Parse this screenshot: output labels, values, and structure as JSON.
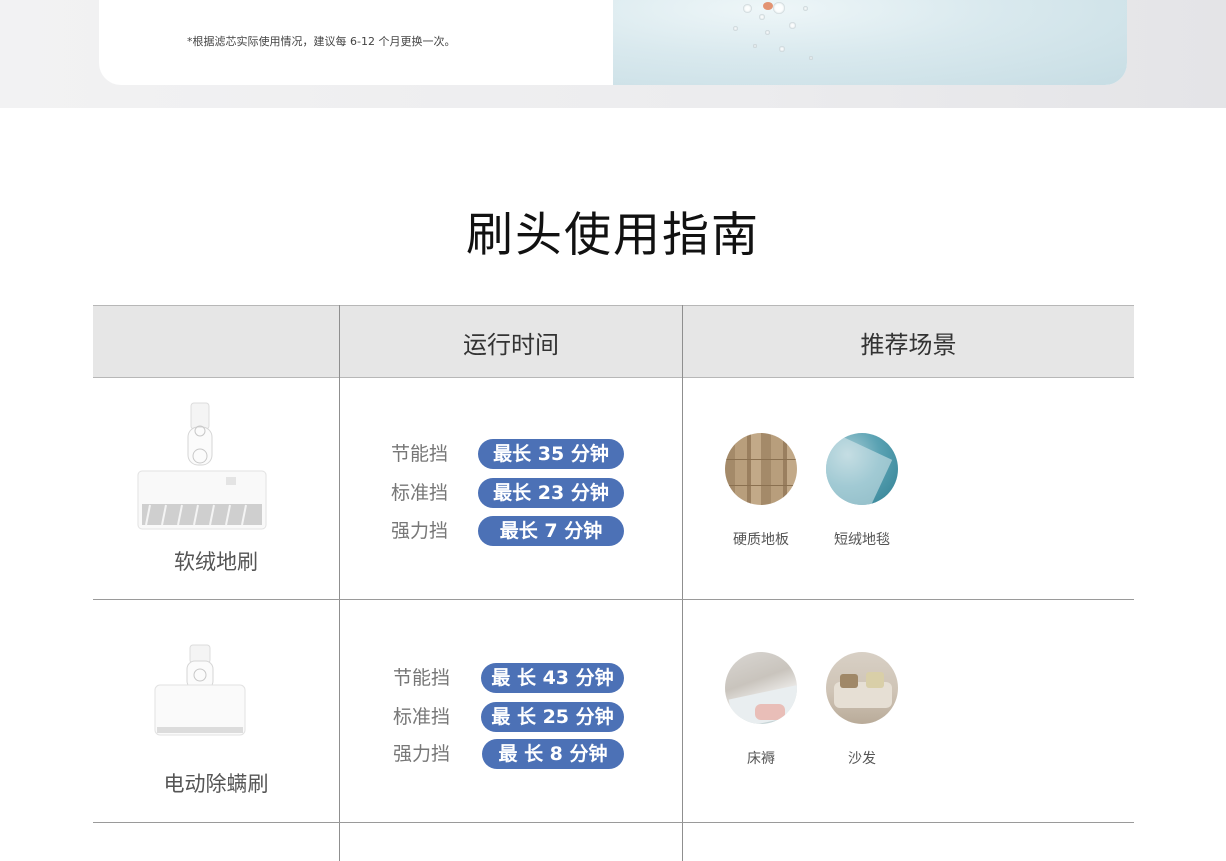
{
  "filter_section": {
    "note": "*根据滤芯实际使用情况，建议每 6-12 个月更换一次。"
  },
  "guide": {
    "title": "刷头使用指南",
    "headers": {
      "col1": "",
      "col2": "运行时间",
      "col3": "推荐场景"
    },
    "rows": [
      {
        "brush_name": "软绒地刷",
        "brush_icon": "soft-floor-brush-icon",
        "modes": [
          {
            "label": "节能挡",
            "time": "最长 35 分钟"
          },
          {
            "label": "标准挡",
            "time": "最长 23 分钟"
          },
          {
            "label": "强力挡",
            "time": "最长 7 分钟"
          }
        ],
        "scenes": [
          {
            "label": "硬质地板",
            "icon": "hardwood-floor-icon"
          },
          {
            "label": "短绒地毯",
            "icon": "short-carpet-icon"
          }
        ]
      },
      {
        "brush_name": "电动除螨刷",
        "brush_icon": "mite-removal-brush-icon",
        "modes": [
          {
            "label": "节能挡",
            "time": "最 长 43 分钟"
          },
          {
            "label": "标准挡",
            "time": "最 长 25 分钟"
          },
          {
            "label": "强力挡",
            "time": "最 长 8 分钟"
          }
        ],
        "scenes": [
          {
            "label": "床褥",
            "icon": "mattress-icon"
          },
          {
            "label": "沙发",
            "icon": "sofa-icon"
          }
        ]
      }
    ]
  },
  "colors": {
    "pill": "#4c71b6",
    "header_bg": "#e6e6e6"
  }
}
